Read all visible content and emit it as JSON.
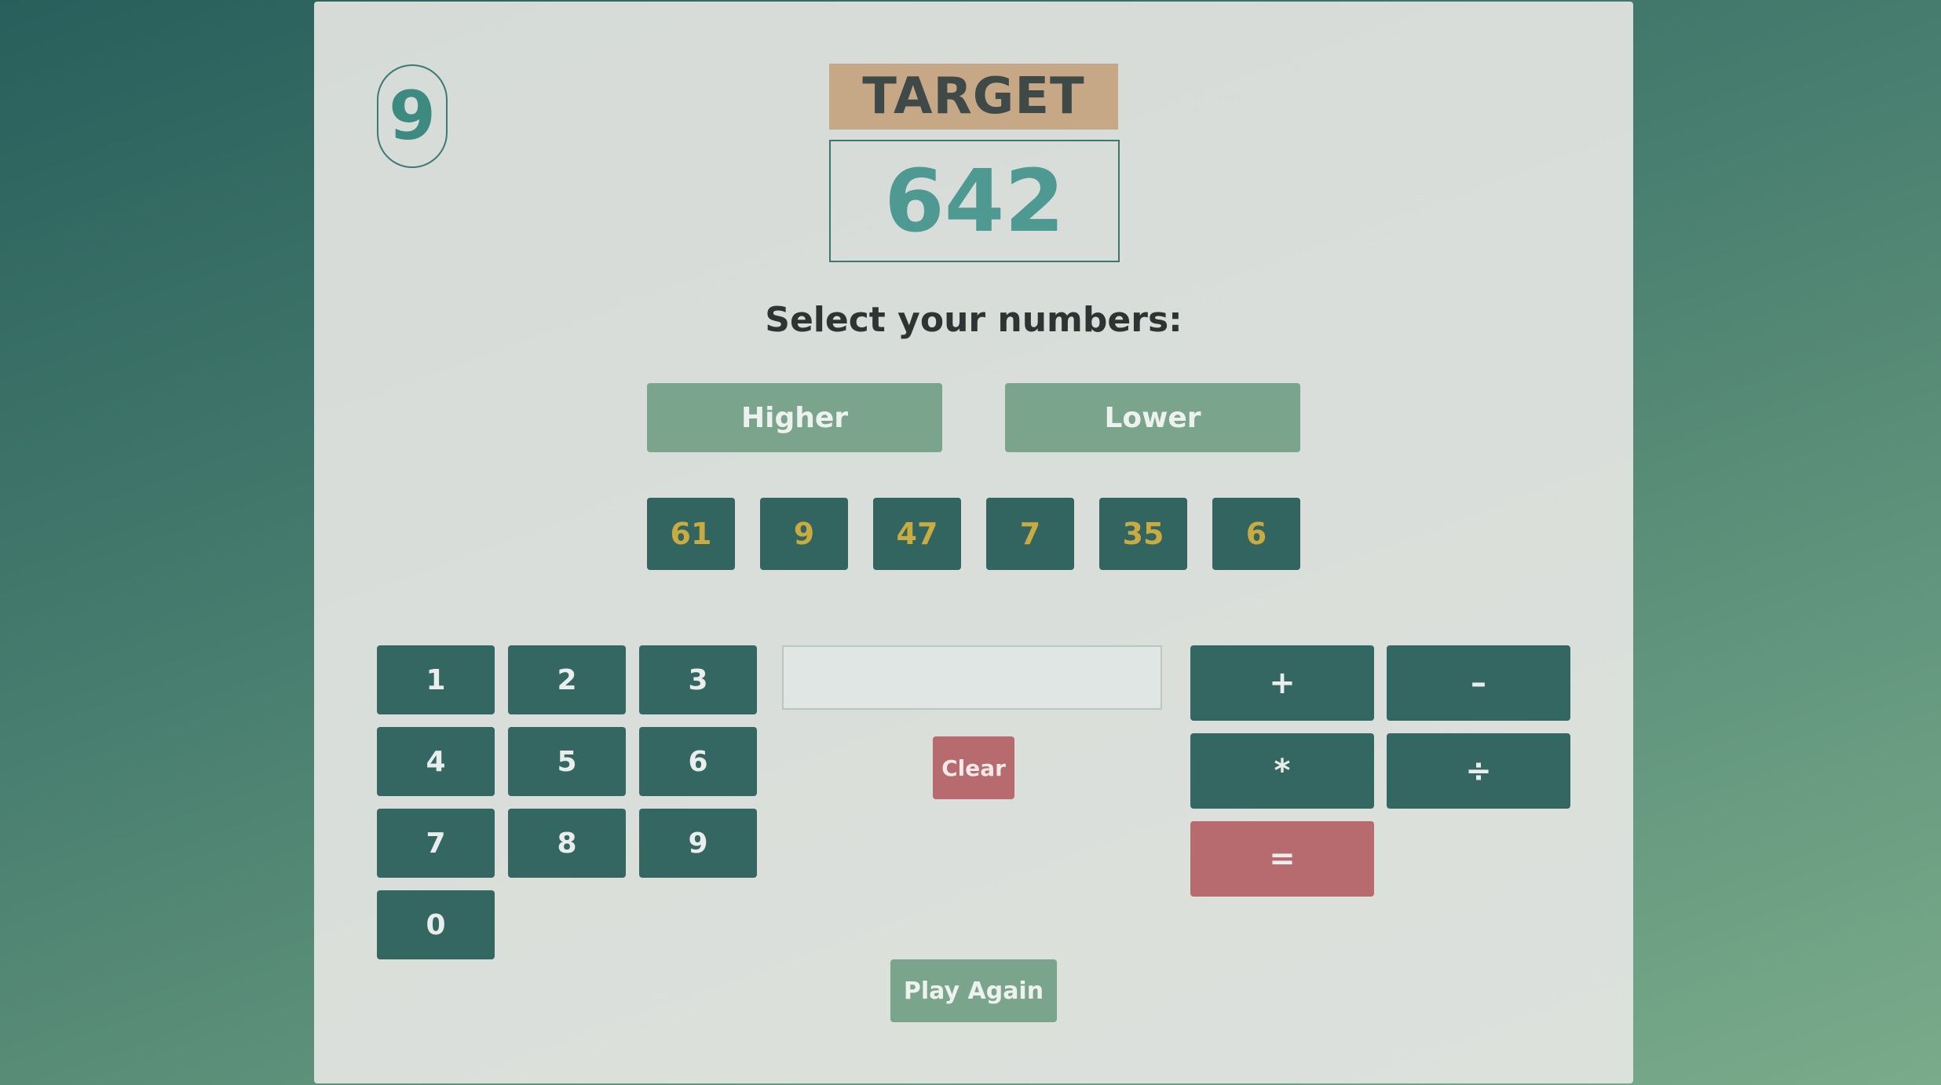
{
  "timer": {
    "value": "9"
  },
  "target": {
    "label": "TARGET",
    "value": "642"
  },
  "prompt": "Select your numbers:",
  "choice_buttons": {
    "higher": "Higher",
    "lower": "Lower"
  },
  "numbers": [
    "61",
    "9",
    "47",
    "7",
    "35",
    "6"
  ],
  "keypad": [
    "1",
    "2",
    "3",
    "4",
    "5",
    "6",
    "7",
    "8",
    "9",
    "0"
  ],
  "expression": {
    "value": ""
  },
  "clear_label": "Clear",
  "operators": {
    "add": "+",
    "subtract": "–",
    "multiply": "*",
    "divide": "÷",
    "equals": "="
  },
  "play_again_label": "Play Again",
  "colors": {
    "accent_dark": "#356762",
    "accent_light": "#7aa48b",
    "danger": "#b86b6e",
    "target_label_bg": "#c6a886",
    "number_text": "#c9ab41"
  }
}
